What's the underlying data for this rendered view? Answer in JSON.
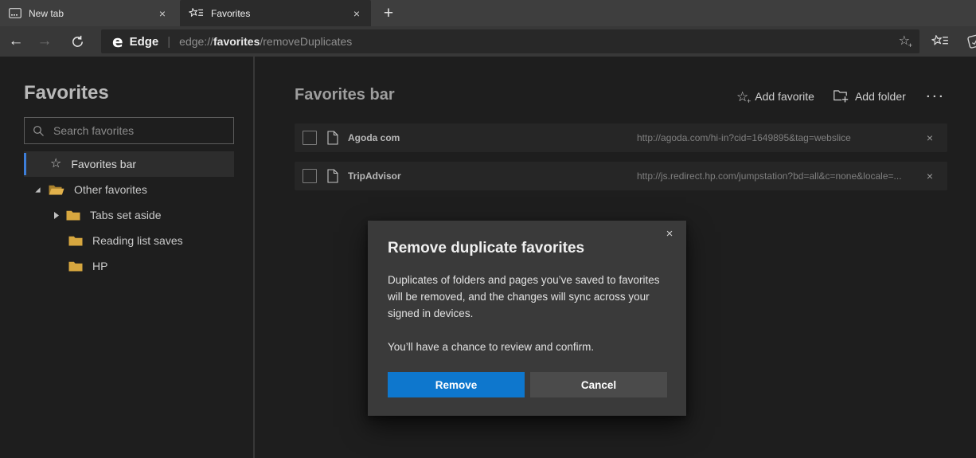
{
  "window": {
    "tabs": [
      {
        "label": "New tab"
      },
      {
        "label": "Favorites"
      }
    ],
    "new_tab_button": "+"
  },
  "navbar": {
    "engine_label": "Edge",
    "separator": "|",
    "url": {
      "scheme": "edge://",
      "host": "favorites",
      "path": "/removeDuplicates"
    }
  },
  "icons": {
    "close": "×",
    "star": "☆",
    "plus": "+",
    "back": "←",
    "forward": "→",
    "edge_logo": "e",
    "more_options": "···"
  },
  "sidebar": {
    "title": "Favorites",
    "search_placeholder": "Search favorites",
    "items": [
      {
        "label": "Favorites bar",
        "icon": "star",
        "selected": true
      },
      {
        "label": "Other favorites",
        "icon": "folder-open",
        "state": "expanded"
      },
      {
        "label": "Tabs set aside",
        "icon": "folder",
        "state": "collapsed"
      },
      {
        "label": "Reading list saves",
        "icon": "folder"
      },
      {
        "label": "HP",
        "icon": "folder"
      }
    ]
  },
  "main": {
    "heading": "Favorites bar",
    "actions": {
      "add_favorite": "Add favorite",
      "add_folder": "Add folder"
    },
    "favorites": [
      {
        "name": "Agoda com",
        "url": "http://agoda.com/hi-in?cid=1649895&tag=webslice"
      },
      {
        "name": "TripAdvisor",
        "url": "http://js.redirect.hp.com/jumpstation?bd=all&c=none&locale=..."
      }
    ]
  },
  "dialog": {
    "title": "Remove duplicate favorites",
    "body_1": "Duplicates of folders and pages you’ve saved to favorites will be removed, and the changes will sync across your signed in devices.",
    "body_2": "You’ll have a chance to review and confirm.",
    "remove_label": "Remove",
    "cancel_label": "Cancel"
  },
  "colors": {
    "accent_blue": "#0e77cd",
    "selection_blue": "#3d7ed9",
    "folder_gold": "#d7a73f"
  }
}
